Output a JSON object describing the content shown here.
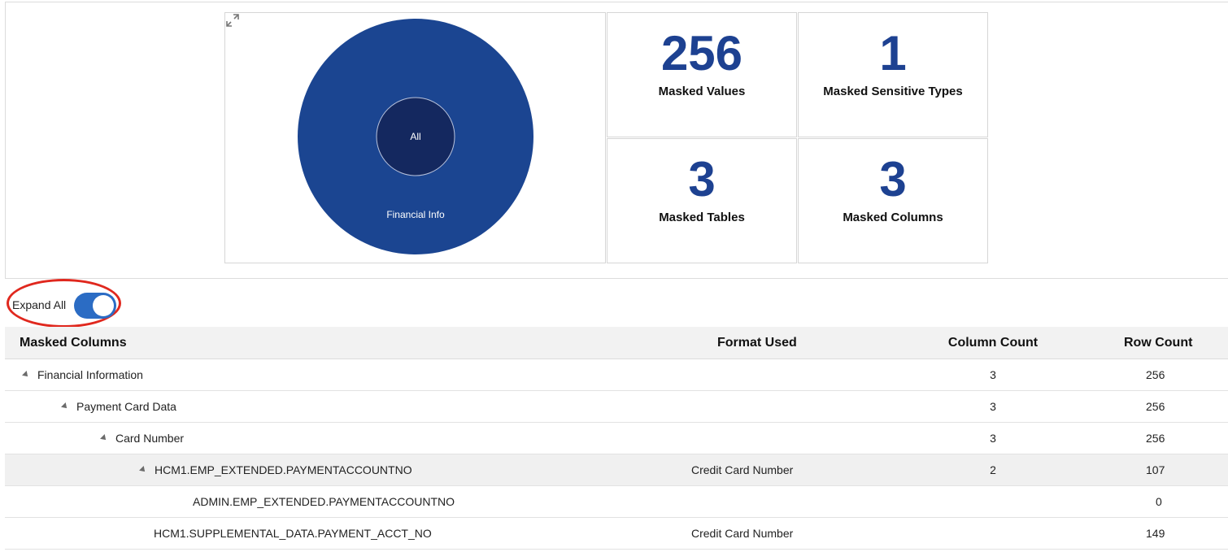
{
  "chart_data": {
    "type": "sunburst",
    "rings": [
      {
        "level": "inner",
        "label": "All",
        "value": 256,
        "color": "#14285f"
      },
      {
        "level": "outer",
        "label": "Financial Info",
        "value": 256,
        "color": "#1b4591"
      }
    ]
  },
  "tiles": {
    "masked_values": {
      "value": "256",
      "label": "Masked Values"
    },
    "sensitive_types": {
      "value": "1",
      "label": "Masked Sensitive Types"
    },
    "masked_tables": {
      "value": "3",
      "label": "Masked Tables"
    },
    "masked_columns": {
      "value": "3",
      "label": "Masked Columns"
    }
  },
  "icons": {
    "expand": "expand-diagonal-icon",
    "disclosure": "triangle-expanded-icon"
  },
  "expand_all": {
    "label": "Expand All",
    "on": true
  },
  "colors": {
    "accent": "#1d4191",
    "toggle": "#2b6cc4",
    "highlight": "#e0281e"
  },
  "table": {
    "headers": {
      "name": "Masked Columns",
      "format": "Format Used",
      "column_count": "Column Count",
      "row_count": "Row Count"
    },
    "rows": [
      {
        "name": "Financial Information",
        "format": "",
        "column_count": "3",
        "row_count": "256"
      },
      {
        "name": "Payment Card Data",
        "format": "",
        "column_count": "3",
        "row_count": "256"
      },
      {
        "name": "Card Number",
        "format": "",
        "column_count": "3",
        "row_count": "256"
      },
      {
        "name": "HCM1.EMP_EXTENDED.PAYMENTACCOUNTNO",
        "format": "Credit Card Number",
        "column_count": "2",
        "row_count": "107"
      },
      {
        "name": "ADMIN.EMP_EXTENDED.PAYMENTACCOUNTNO",
        "format": "",
        "column_count": "",
        "row_count": "0"
      },
      {
        "name": "HCM1.SUPPLEMENTAL_DATA.PAYMENT_ACCT_NO",
        "format": "Credit Card Number",
        "column_count": "",
        "row_count": "149"
      }
    ]
  }
}
